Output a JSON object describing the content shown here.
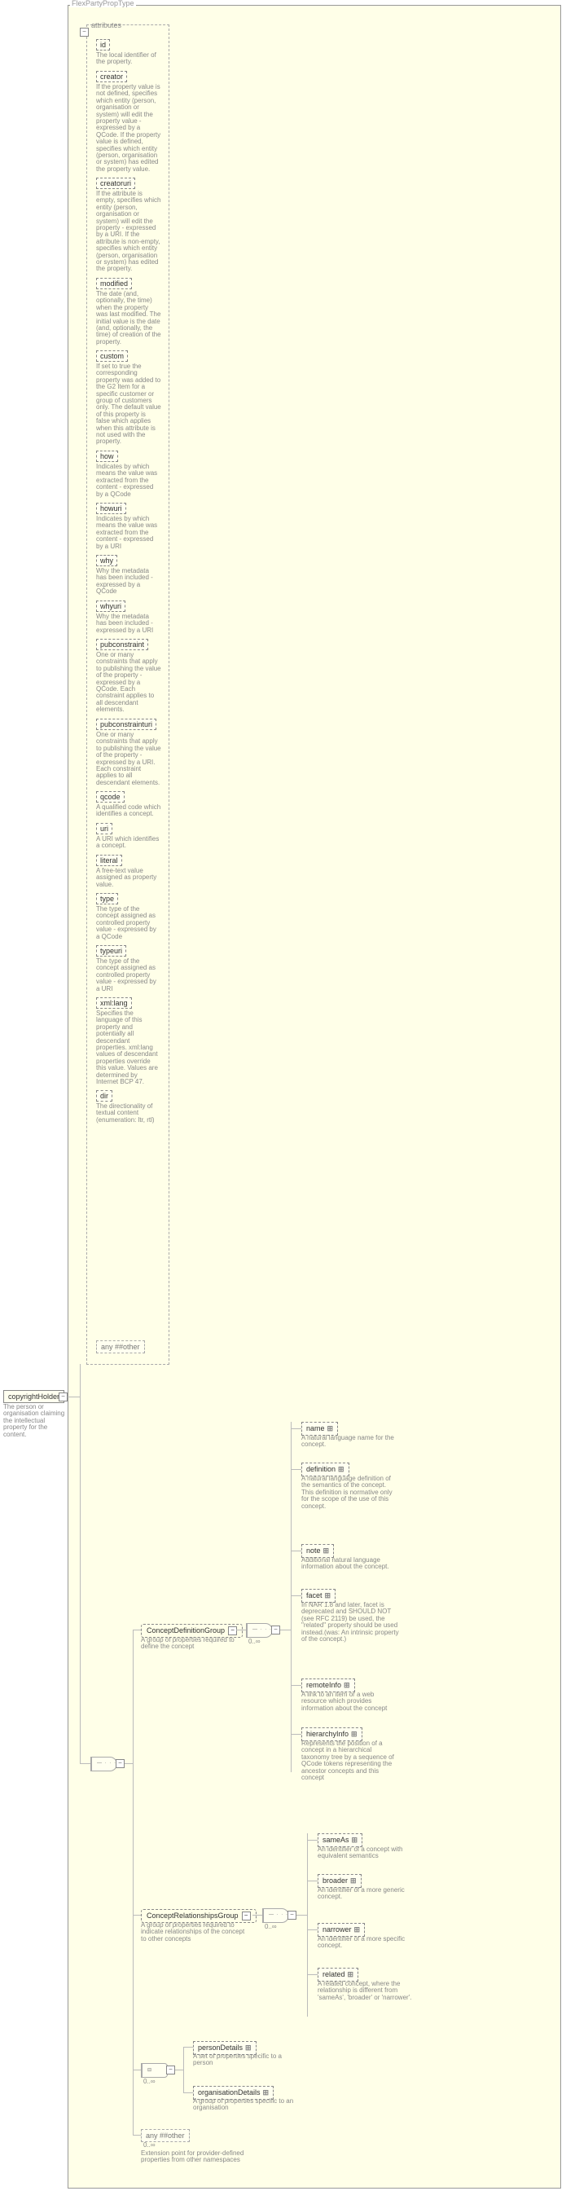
{
  "typeName": "FlexPartyPropType",
  "root": {
    "name": "copyrightHolder",
    "desc": "The person or organisation claiming the intellectual property for the content."
  },
  "attributesHeader": "attributes",
  "attributes": [
    {
      "name": "id",
      "desc": "The local identifier of the property."
    },
    {
      "name": "creator",
      "desc": "If the property value is not defined, specifies which entity (person, organisation or system) will edit the property value - expressed by a QCode. If the property value is defined, specifies which entity (person, organisation or system) has edited the property value."
    },
    {
      "name": "creatoruri",
      "desc": "If the attribute is empty, specifies which entity (person, organisation or system) will edit the property - expressed by a URI. If the attribute is non-empty, specifies which entity (person, organisation or system) has edited the property."
    },
    {
      "name": "modified",
      "desc": "The date (and, optionally, the time) when the property was last modified. The initial value is the date (and, optionally, the time) of creation of the property."
    },
    {
      "name": "custom",
      "desc": "If set to true the corresponding property was added to the G2 Item for a specific customer or group of customers only. The default value of this property is false which applies when this attribute is not used with the property."
    },
    {
      "name": "how",
      "desc": "Indicates by which means the value was extracted from the content - expressed by a QCode"
    },
    {
      "name": "howuri",
      "desc": "Indicates by which means the value was extracted from the content - expressed by a URI"
    },
    {
      "name": "why",
      "desc": "Why the metadata has been included - expressed by a QCode"
    },
    {
      "name": "whyuri",
      "desc": "Why the metadata has been included - expressed by a URI"
    },
    {
      "name": "pubconstraint",
      "desc": "One or many constraints that apply to publishing the value of the property - expressed by a QCode. Each constraint applies to all descendant elements."
    },
    {
      "name": "pubconstrainturi",
      "desc": "One or many constraints that apply to publishing the value of the property - expressed by a URI. Each constraint applies to all descendant elements."
    },
    {
      "name": "qcode",
      "desc": "A qualified code which identifies a concept."
    },
    {
      "name": "uri",
      "desc": "A URI which identifies a concept."
    },
    {
      "name": "literal",
      "desc": "A free-text value assigned as property value."
    },
    {
      "name": "type",
      "desc": "The type of the concept assigned as controlled property value - expressed by a QCode"
    },
    {
      "name": "typeuri",
      "desc": "The type of the concept assigned as controlled property value - expressed by a URI"
    },
    {
      "name": "xml:lang",
      "desc": "Specifies the language of this property and potentially all descendant properties. xml:lang values of descendant properties override this value. Values are determined by Internet BCP 47."
    },
    {
      "name": "dir",
      "desc": "The directionality of textual content (enumeration: ltr, rtl)"
    }
  ],
  "anyAttr": "any ##other",
  "groups": {
    "cdg": {
      "name": "ConceptDefinitionGroup",
      "desc": "A group of properties required to define the concept",
      "occur": "0..∞"
    },
    "crg": {
      "name": "ConceptRelationshipsGroup",
      "desc": "A group of properties required to indicate relationships of the concept to other concepts",
      "occur": "0..∞"
    },
    "choiceOccur": "0..∞",
    "anyOther": "any ##other",
    "anyOtherOccur": "0..∞",
    "anyOtherDesc": "Extension point for provider-defined properties from other namespaces"
  },
  "cdgChildren": [
    {
      "name": "name",
      "desc": "A natural language name for the concept."
    },
    {
      "name": "definition",
      "desc": "A natural language definition of the semantics of the concept. This definition is normative only for the scope of the use of this concept."
    },
    {
      "name": "note",
      "desc": "Additional natural language information about the concept."
    },
    {
      "name": "facet",
      "desc": "In NAR 1.8 and later, facet is deprecated and SHOULD NOT (see RFC 2119) be used, the \"related\" property should be used instead.(was: An intrinsic property of the concept.)"
    },
    {
      "name": "remoteInfo",
      "desc": "A link to an item or a web resource which provides information about the concept"
    },
    {
      "name": "hierarchyInfo",
      "desc": "Represents the position of a concept in a hierarchical taxonomy tree by a sequence of QCode tokens representing the ancestor concepts and this concept"
    }
  ],
  "crgChildren": [
    {
      "name": "sameAs",
      "desc": "An identifier of a concept with equivalent semantics"
    },
    {
      "name": "broader",
      "desc": "An identifier of a more generic concept."
    },
    {
      "name": "narrower",
      "desc": "An identifier of a more specific concept."
    },
    {
      "name": "related",
      "desc": "A related concept, where the relationship is different from 'sameAs', 'broader' or 'narrower'."
    }
  ],
  "details": {
    "person": {
      "name": "personDetails",
      "desc": "A set of properties specific to a person"
    },
    "org": {
      "name": "organisationDetails",
      "desc": "A group of properties specific to an organisation"
    }
  }
}
